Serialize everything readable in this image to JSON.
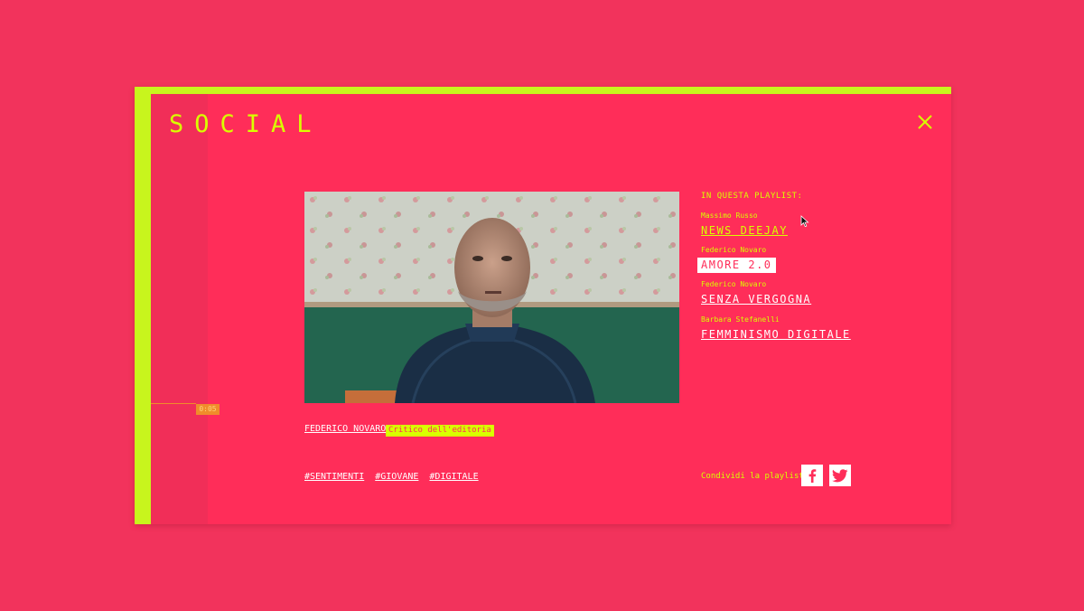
{
  "modal": {
    "title": "SOCIAL",
    "close_icon": "close-icon",
    "timeline_time": "0:05"
  },
  "video": {
    "speaker_name": "FEDERICO NOVARO",
    "speaker_role": "Critico dell'editoria"
  },
  "tags": [
    "#SENTIMENTI",
    "#GIOVANE",
    "#DIGITALE"
  ],
  "playlist": {
    "heading": "IN QUESTA PLAYLIST:",
    "items": [
      {
        "author": "Massimo Russo",
        "title": "NEWS DEEJAY",
        "state": "normal"
      },
      {
        "author": "Federico Novaro",
        "title": "AMORE 2.0",
        "state": "active"
      },
      {
        "author": "Federico Novaro",
        "title": "SENZA VERGOGNA",
        "state": "normal"
      },
      {
        "author": "Barbara Stefanelli",
        "title": "FEMMINISMO DIGITALE",
        "state": "normal"
      }
    ]
  },
  "share": {
    "label": "Condividi la playlist",
    "facebook_icon": "facebook-icon",
    "twitter_icon": "twitter-icon"
  },
  "colors": {
    "background": "#f2335c",
    "panel": "#ff2d59",
    "accent": "#d9ff00",
    "timeline": "#f08c2b"
  }
}
